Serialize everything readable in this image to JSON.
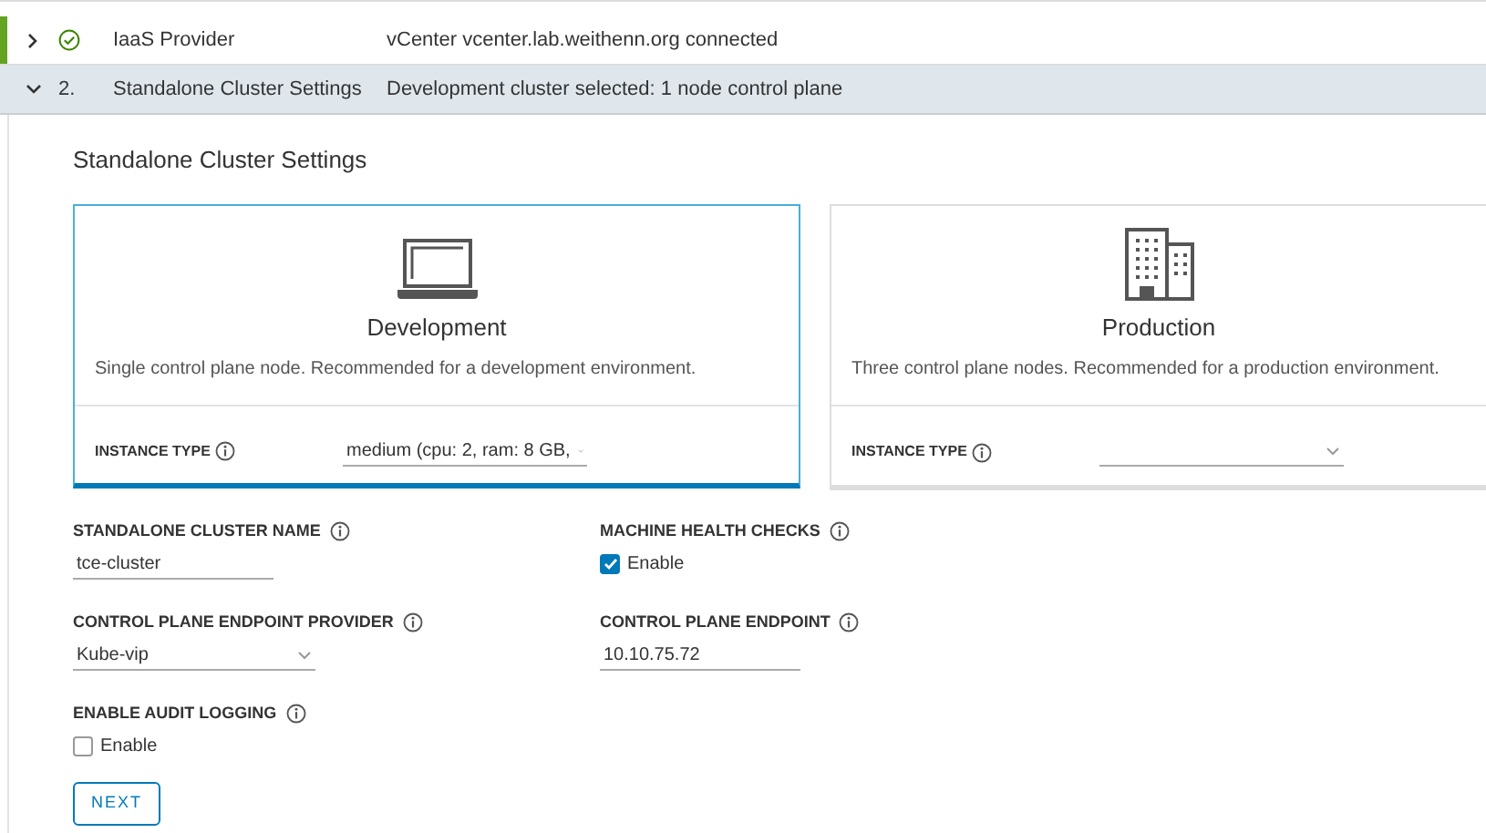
{
  "steps": [
    {
      "kind": "done",
      "title": "IaaS Provider",
      "summary": "vCenter vcenter.lab.weithenn.org connected",
      "expanded": false,
      "completed": true
    },
    {
      "kind": "numbered",
      "number": "2.",
      "title": "Standalone Cluster Settings",
      "summary": "Development cluster selected: 1 node control plane",
      "expanded": true,
      "completed": false
    }
  ],
  "section_title": "Standalone Cluster Settings",
  "plans": [
    {
      "kind": "laptop",
      "title": "Development",
      "description": "Single control plane node. Recommended for a development environment.",
      "selected": true,
      "instance_label": "INSTANCE TYPE",
      "instance_value": "medium (cpu: 2, ram: 8 GB,"
    },
    {
      "kind": "buildings",
      "title": "Production",
      "description": "Three control plane nodes. Recommended for a production environment.",
      "selected": false,
      "instance_label": "INSTANCE TYPE"
    }
  ],
  "fields": [
    {
      "kind": "text",
      "label": "STANDALONE CLUSTER NAME",
      "value": "tce-cluster"
    },
    {
      "kind": "checkbox",
      "label": "MACHINE HEALTH CHECKS",
      "option": "Enable",
      "checked": true
    },
    {
      "kind": "select",
      "label": "CONTROL PLANE ENDPOINT PROVIDER",
      "value": "Kube-vip"
    },
    {
      "kind": "text",
      "label": "CONTROL PLANE ENDPOINT",
      "value": "10.10.75.72"
    },
    {
      "kind": "checkbox",
      "label": "ENABLE AUDIT LOGGING",
      "option": "Enable",
      "checked": false
    }
  ],
  "next_button": "NEXT"
}
